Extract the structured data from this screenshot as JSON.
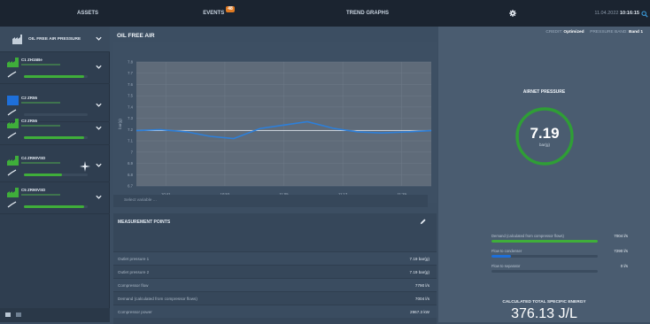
{
  "topbar": {
    "tabs": [
      {
        "label": "ASSETS"
      },
      {
        "label": "EVENTS",
        "badge": "48"
      },
      {
        "label": "TREND GRAPHS"
      }
    ],
    "clock_label": "11.04.2022",
    "clock_time": "10:16:15"
  },
  "sidebar": {
    "site_name": "OIL FREE AIR PRESSURE",
    "assets": [
      {
        "name": "C1 ZH15Be",
        "fill_pct": 95,
        "color": "#3fae3a"
      },
      {
        "name": "C2 ZR55",
        "fill_pct": 0,
        "color": "#1e6fd9"
      },
      {
        "name": "C3 ZR55",
        "fill_pct": 95,
        "color": "#3fae3a"
      },
      {
        "name": "C4 ZR90VSD",
        "fill_pct": 60,
        "color": "#3fae3a"
      },
      {
        "name": "C5 ZR90VSD",
        "fill_pct": 95,
        "color": "#3fae3a"
      }
    ]
  },
  "main": {
    "title": "OIL FREE AIR",
    "filter_text": "Select variable ...",
    "measurement": {
      "title": "MEASUREMENT POINTS",
      "rows": [
        {
          "label": "Outlet pressure 1",
          "value": "7.19 bar(g)"
        },
        {
          "label": "Outlet pressure 2",
          "value": "7.19 bar(g)"
        },
        {
          "label": "Compressor flow",
          "value": "7790 l/s"
        },
        {
          "label": "Demand (calculated from compressor flows)",
          "value": "7004 l/s"
        },
        {
          "label": "Compressor power",
          "value": "2967.3 kW"
        }
      ]
    }
  },
  "chart_data": {
    "type": "line",
    "title": "",
    "xlabel": "",
    "ylabel": "bar(g)",
    "x_ticks": [
      "10:41",
      "10:53",
      "11:05",
      "11:17",
      "11:29"
    ],
    "y_ticks": [
      6.7,
      6.8,
      6.9,
      7.0,
      7.1,
      7.2,
      7.3,
      7.4,
      7.5,
      7.6,
      7.7,
      7.8
    ],
    "ylim": [
      6.7,
      7.8
    ],
    "setpoint": 7.19,
    "series": [
      {
        "name": "",
        "color": "#2d7fd9",
        "x": [
          0,
          0.08,
          0.17,
          0.25,
          0.33,
          0.42,
          0.5,
          0.58,
          0.67,
          0.75,
          0.83,
          0.92,
          1.0
        ],
        "values": [
          7.19,
          7.2,
          7.18,
          7.14,
          7.12,
          7.21,
          7.24,
          7.27,
          7.21,
          7.18,
          7.17,
          7.18,
          7.19
        ]
      }
    ]
  },
  "right": {
    "status_label": "CREDIT:",
    "status_value": "Optimized",
    "pressure_band_label": "PRESSURE BAND:",
    "pressure_band_value": "Band 1",
    "ap_title": "AIRNET PRESSURE",
    "ap_value": "7.19",
    "ap_unit": "bar(g)",
    "bars": [
      {
        "label": "Demand (calculated from compressor flows)",
        "value": "7004 l/s",
        "fill_pct": 100,
        "color": "#3fae3a"
      },
      {
        "label": "Flow to condenser",
        "value": "7290 l/s",
        "fill_pct": 18,
        "color": "#1e6fd9"
      },
      {
        "label": "Flow to separator",
        "value": "0 l/s",
        "fill_pct": 0,
        "color": "#3fae3a"
      }
    ],
    "cs_title": "CALCULATED TOTAL SPECIFIC ENERGY",
    "cs_value": "376.13 J/L"
  },
  "colors": {
    "accent_green": "#3fae3a",
    "accent_blue": "#1e6fd9",
    "badge_orange": "#e07a22"
  }
}
